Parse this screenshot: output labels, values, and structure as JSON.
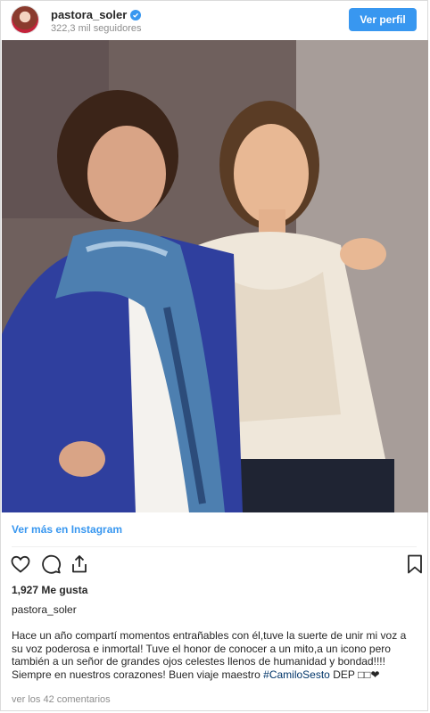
{
  "header": {
    "username": "pastora_soler",
    "followers": "322,3 mil seguidores",
    "view_profile_label": "Ver perfil"
  },
  "photo": {
    "alt_icon": "photo"
  },
  "view_more_label": "Ver más en Instagram",
  "actions": {
    "like_icon": "heart-icon",
    "comment_icon": "comment-icon",
    "share_icon": "share-icon",
    "save_icon": "bookmark-icon"
  },
  "likes": "1,927 Me gusta",
  "owner": "pastora_soler",
  "caption": {
    "line1": "Hace un año compartí momentos entrañables con él,tuve la suerte de unir mi voz a",
    "line2": "su voz poderosa e inmortal! Tuve el honor de conocer a un mito,a un icono pero",
    "line3": "también a un señor de grandes ojos celestes llenos de humanidad y bondad!!!!",
    "line4_pre": "Siempre en nuestros corazones! Buen viaje maestro ",
    "hashtag": "#CamiloSesto",
    "line4_post": " DEP □□❤"
  },
  "comments_link": "ver los 42 comentarios",
  "colors": {
    "accent": "#3897f0",
    "hashtag": "#003569",
    "muted": "#8e8e8e"
  }
}
